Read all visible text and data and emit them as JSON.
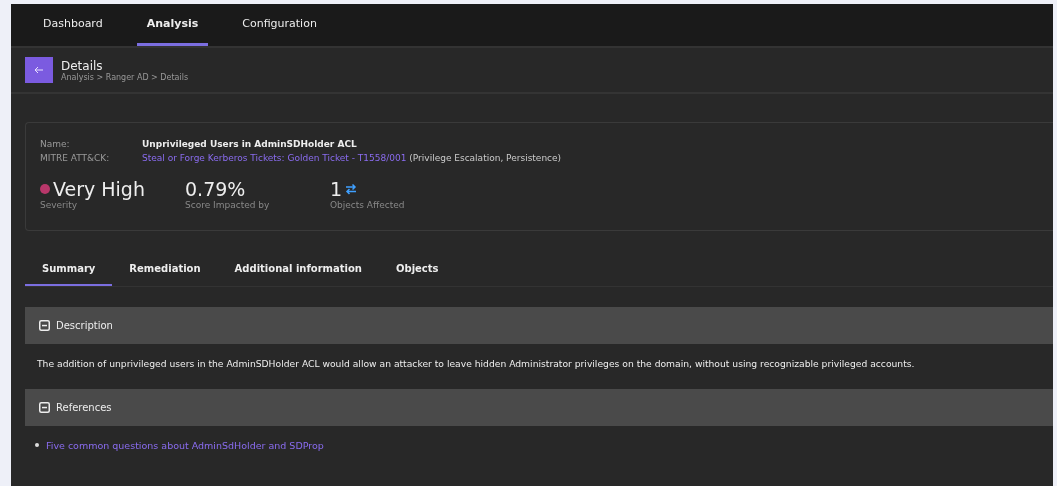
{
  "nav": {
    "tabs": [
      {
        "label": "Dashboard",
        "selected": false
      },
      {
        "label": "Analysis",
        "selected": true
      },
      {
        "label": "Configuration",
        "selected": false
      }
    ]
  },
  "header": {
    "title": "Details",
    "breadcrumb": "Analysis > Ranger AD > Details"
  },
  "summary_card": {
    "fields": [
      {
        "label": "Name:",
        "value": "Unprivileged Users in AdminSDHolder ACL",
        "kind": "text"
      },
      {
        "label": "MITRE ATT&CK:",
        "link": "Steal or Forge Kerberos Tickets: Golden Ticket - T1558/001",
        "value": "(Privilege Escalation, Persistence)",
        "kind": "link"
      }
    ],
    "stats": [
      {
        "value": "Very High",
        "label": "Severity",
        "color": "#b8376a",
        "kind": "severity"
      },
      {
        "value": "0.79%",
        "label": "Score Impacted by",
        "kind": "plain"
      },
      {
        "value": "1",
        "label": "Objects Affected",
        "kind": "objects"
      }
    ]
  },
  "detail_tabs": [
    {
      "label": "Summary",
      "selected": true
    },
    {
      "label": "Remediation",
      "selected": false
    },
    {
      "label": "Additional information",
      "selected": false
    },
    {
      "label": "Objects",
      "selected": false
    }
  ],
  "sections": [
    {
      "title": "Description",
      "expanded": true,
      "kind": "text",
      "text": "The addition of unprivileged users in the AdminSDHolder ACL would allow an attacker to leave hidden Administrator privileges on the domain, without using recognizable privileged accounts."
    },
    {
      "title": "References",
      "expanded": true,
      "kind": "links",
      "links": [
        "Five common questions about AdminSdHolder and SDProp"
      ]
    }
  ]
}
